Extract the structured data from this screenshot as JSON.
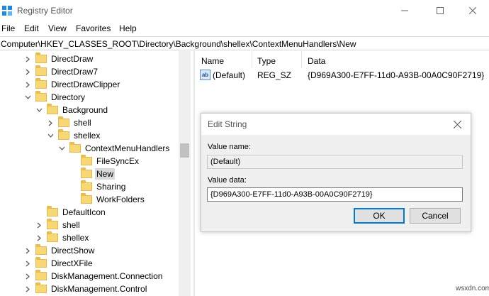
{
  "window": {
    "title": "Registry Editor",
    "menus": [
      "File",
      "Edit",
      "View",
      "Favorites",
      "Help"
    ]
  },
  "address": "Computer\\HKEY_CLASSES_ROOT\\Directory\\Background\\shellex\\ContextMenuHandlers\\New",
  "tree": {
    "items": [
      {
        "label": "DirectDraw"
      },
      {
        "label": "DirectDraw7"
      },
      {
        "label": "DirectDrawClipper"
      },
      {
        "label": "Directory"
      },
      {
        "label": "Background"
      },
      {
        "label": "shell"
      },
      {
        "label": "shellex"
      },
      {
        "label": "ContextMenuHandlers"
      },
      {
        "label": "FileSyncEx"
      },
      {
        "label": "New"
      },
      {
        "label": "Sharing"
      },
      {
        "label": "WorkFolders"
      },
      {
        "label": "DefaultIcon"
      },
      {
        "label": "shell"
      },
      {
        "label": "shellex"
      },
      {
        "label": "DirectShow"
      },
      {
        "label": "DirectXFile"
      },
      {
        "label": "DiskManagement.Connection"
      },
      {
        "label": "DiskManagement.Control"
      }
    ]
  },
  "list": {
    "columns": [
      "Name",
      "Type",
      "Data"
    ],
    "rows": [
      {
        "name": "(Default)",
        "type": "REG_SZ",
        "data": "{D969A300-E7FF-11d0-A93B-00A0C90F2719}",
        "icon": "string-value-icon"
      }
    ]
  },
  "dialog": {
    "title": "Edit String",
    "value_name_label": "Value name:",
    "value_name": "(Default)",
    "value_data_label": "Value data:",
    "value_data": "{D969A300-E7FF-11d0-A93B-00A0C90F2719}",
    "ok_label": "OK",
    "cancel_label": "Cancel"
  },
  "watermark": "wsxdn.com",
  "colors": {
    "selection": "#d9d9d9",
    "folder": "#f8d775",
    "accent": "#0078d7"
  }
}
